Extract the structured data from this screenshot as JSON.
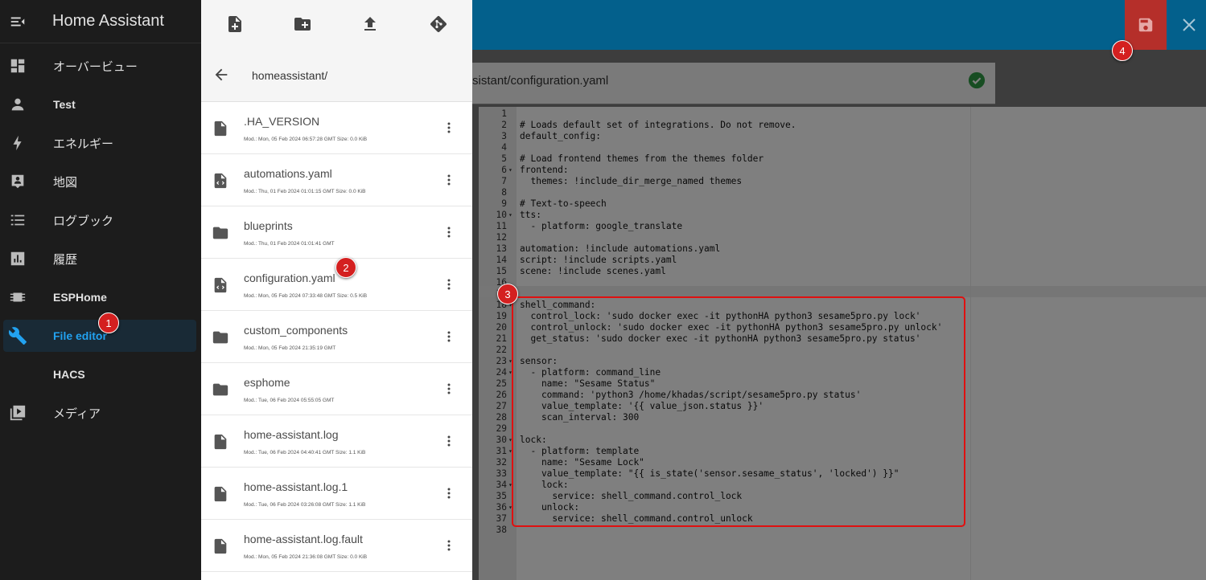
{
  "app": {
    "title": "Home Assistant"
  },
  "sidebar": {
    "items": [
      {
        "label": "オーバービュー",
        "icon": "dashboard-icon",
        "active": false
      },
      {
        "label": "Test",
        "icon": "person-icon",
        "active": false
      },
      {
        "label": "エネルギー",
        "icon": "lightning-icon",
        "active": false
      },
      {
        "label": "地図",
        "icon": "map-account-icon",
        "active": false
      },
      {
        "label": "ログブック",
        "icon": "list-icon",
        "active": false
      },
      {
        "label": "履歴",
        "icon": "chart-icon",
        "active": false
      },
      {
        "label": "ESPHome",
        "icon": "chip-icon",
        "active": false
      },
      {
        "label": "File editor",
        "icon": "wrench-icon",
        "active": true
      },
      {
        "label": "HACS",
        "icon": "hacs-icon",
        "active": false
      },
      {
        "label": "メディア",
        "icon": "media-icon",
        "active": false
      }
    ]
  },
  "file_browser": {
    "toolbar": [
      "new-file-icon",
      "new-folder-icon",
      "upload-icon",
      "git-icon"
    ],
    "path": "homeassistant/",
    "files": [
      {
        "name": ".HA_VERSION",
        "type": "file",
        "meta": "Mod.: Mon, 05 Feb 2024 06:57:28 GMT  Size: 0.0 KiB"
      },
      {
        "name": "automations.yaml",
        "type": "code",
        "meta": "Mod.: Thu, 01 Feb 2024 01:01:15 GMT  Size: 0.0 KiB"
      },
      {
        "name": "blueprints",
        "type": "folder",
        "meta": "Mod.: Thu, 01 Feb 2024 01:01:41 GMT"
      },
      {
        "name": "configuration.yaml",
        "type": "code",
        "meta": "Mod.: Mon, 05 Feb 2024 07:33:48 GMT  Size: 0.5 KiB"
      },
      {
        "name": "custom_components",
        "type": "folder",
        "meta": "Mod.: Mon, 05 Feb 2024 21:35:19 GMT"
      },
      {
        "name": "esphome",
        "type": "folder",
        "meta": "Mod.: Tue, 06 Feb 2024 05:55:05 GMT"
      },
      {
        "name": "home-assistant.log",
        "type": "file",
        "meta": "Mod.: Tue, 06 Feb 2024 04:40:41 GMT  Size: 1.1 KiB"
      },
      {
        "name": "home-assistant.log.1",
        "type": "file",
        "meta": "Mod.: Tue, 06 Feb 2024 03:26:08 GMT  Size: 1.1 KiB"
      },
      {
        "name": "home-assistant.log.fault",
        "type": "file",
        "meta": "Mod.: Mon, 05 Feb 2024 21:36:08 GMT  Size: 0.0 KiB"
      }
    ]
  },
  "editor": {
    "filename": "sistant/configuration.yaml",
    "status": "saved",
    "lines": [
      {
        "n": "1",
        "fold": "",
        "text": "",
        "kind": "plain"
      },
      {
        "n": "2",
        "fold": "",
        "text": "# Loads default set of integrations. Do not remove.",
        "kind": "comment"
      },
      {
        "n": "3",
        "fold": "",
        "text": "default_config:",
        "kind": "key"
      },
      {
        "n": "4",
        "fold": "",
        "text": "",
        "kind": "plain"
      },
      {
        "n": "5",
        "fold": "",
        "text": "# Load frontend themes from the themes folder",
        "kind": "comment"
      },
      {
        "n": "6",
        "fold": "▾",
        "text": "frontend:",
        "kind": "key"
      },
      {
        "n": "7",
        "fold": "",
        "text": "  themes: !include_dir_merge_named themes",
        "kind": "plain"
      },
      {
        "n": "8",
        "fold": "",
        "text": "",
        "kind": "plain"
      },
      {
        "n": "9",
        "fold": "",
        "text": "# Text-to-speech",
        "kind": "comment"
      },
      {
        "n": "10",
        "fold": "▾",
        "text": "tts:",
        "kind": "key"
      },
      {
        "n": "11",
        "fold": "",
        "text": "  - platform: google_translate",
        "kind": "plain"
      },
      {
        "n": "12",
        "fold": "",
        "text": "",
        "kind": "plain"
      },
      {
        "n": "13",
        "fold": "",
        "text": "automation: !include automations.yaml",
        "kind": "plain"
      },
      {
        "n": "14",
        "fold": "",
        "text": "script: !include scripts.yaml",
        "kind": "plain"
      },
      {
        "n": "15",
        "fold": "",
        "text": "scene: !include scenes.yaml",
        "kind": "plain"
      },
      {
        "n": "16",
        "fold": "",
        "text": "",
        "kind": "plain"
      },
      {
        "n": "17",
        "fold": "",
        "text": "",
        "kind": "plain"
      },
      {
        "n": "18",
        "fold": "▾",
        "text": "shell_command:",
        "kind": "key"
      },
      {
        "n": "19",
        "fold": "",
        "text": "  control_lock: 'sudo docker exec -it pythonHA python3 sesame5pro.py lock'",
        "kind": "plain"
      },
      {
        "n": "20",
        "fold": "",
        "text": "  control_unlock: 'sudo docker exec -it pythonHA python3 sesame5pro.py unlock'",
        "kind": "plain"
      },
      {
        "n": "21",
        "fold": "",
        "text": "  get_status: 'sudo docker exec -it pythonHA python3 sesame5pro.py status'",
        "kind": "plain"
      },
      {
        "n": "22",
        "fold": "",
        "text": "",
        "kind": "plain"
      },
      {
        "n": "23",
        "fold": "▾",
        "text": "sensor:",
        "kind": "key"
      },
      {
        "n": "24",
        "fold": "▾",
        "text": "  - platform: command_line",
        "kind": "plain"
      },
      {
        "n": "25",
        "fold": "",
        "text": "    name: \"Sesame Status\"",
        "kind": "plain"
      },
      {
        "n": "26",
        "fold": "",
        "text": "    command: 'python3 /home/khadas/script/sesame5pro.py status'",
        "kind": "plain"
      },
      {
        "n": "27",
        "fold": "",
        "text": "    value_template: '{{ value_json.status }}'",
        "kind": "plain"
      },
      {
        "n": "28",
        "fold": "",
        "text": "    scan_interval: 300",
        "kind": "plain"
      },
      {
        "n": "29",
        "fold": "",
        "text": "",
        "kind": "plain"
      },
      {
        "n": "30",
        "fold": "▾",
        "text": "lock:",
        "kind": "key"
      },
      {
        "n": "31",
        "fold": "▾",
        "text": "  - platform: template",
        "kind": "plain"
      },
      {
        "n": "32",
        "fold": "",
        "text": "    name: \"Sesame Lock\"",
        "kind": "plain"
      },
      {
        "n": "33",
        "fold": "",
        "text": "    value_template: \"{{ is_state('sensor.sesame_status', 'locked') }}\"",
        "kind": "plain"
      },
      {
        "n": "34",
        "fold": "▾",
        "text": "    lock:",
        "kind": "plain"
      },
      {
        "n": "35",
        "fold": "",
        "text": "      service: shell_command.control_lock",
        "kind": "plain"
      },
      {
        "n": "36",
        "fold": "▾",
        "text": "    unlock:",
        "kind": "plain"
      },
      {
        "n": "37",
        "fold": "",
        "text": "      service: shell_command.control_unlock",
        "kind": "plain"
      },
      {
        "n": "38",
        "fold": "",
        "text": "",
        "kind": "plain"
      }
    ]
  },
  "annotations": [
    {
      "label": "1",
      "target": "File editor"
    },
    {
      "label": "2",
      "target": "configuration.yaml"
    },
    {
      "label": "3",
      "target": "shell_command / sensor / lock block"
    },
    {
      "label": "4",
      "target": "save-button"
    }
  ],
  "colors": {
    "topbar": "#03608c",
    "sidebar": "#1c1c1c",
    "accent": "#22a2f0",
    "save": "#b52f2a",
    "annotation": "#d42020"
  }
}
